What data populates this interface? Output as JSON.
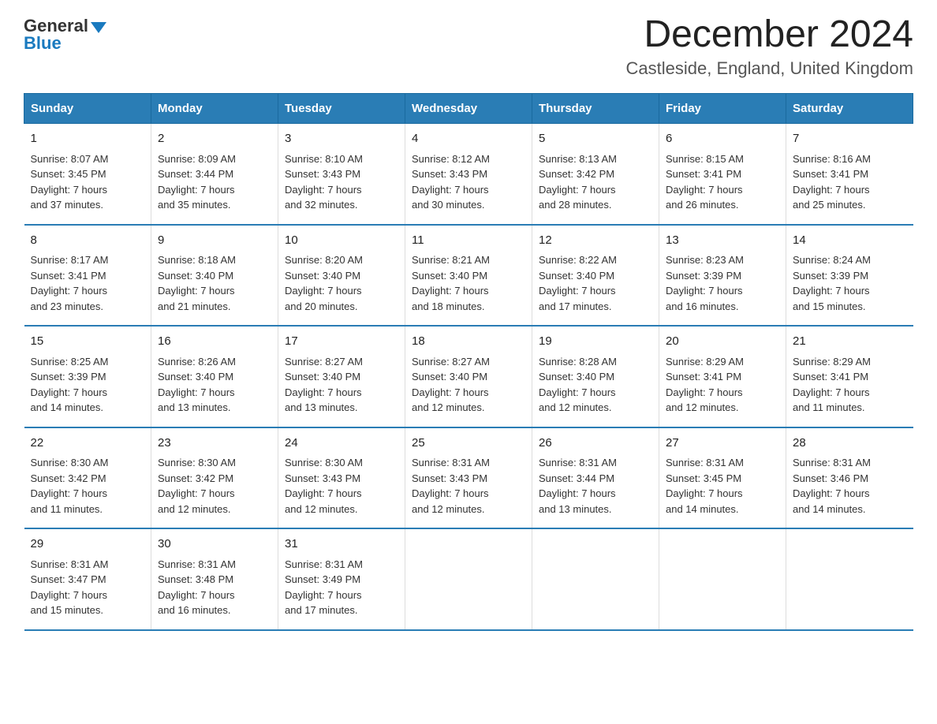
{
  "logo": {
    "general": "General",
    "arrow": "▶",
    "blue": "Blue"
  },
  "header": {
    "month_year": "December 2024",
    "location": "Castleside, England, United Kingdom"
  },
  "weekdays": [
    "Sunday",
    "Monday",
    "Tuesday",
    "Wednesday",
    "Thursday",
    "Friday",
    "Saturday"
  ],
  "weeks": [
    [
      {
        "day": "1",
        "sunrise": "Sunrise: 8:07 AM",
        "sunset": "Sunset: 3:45 PM",
        "daylight": "Daylight: 7 hours",
        "daylight2": "and 37 minutes."
      },
      {
        "day": "2",
        "sunrise": "Sunrise: 8:09 AM",
        "sunset": "Sunset: 3:44 PM",
        "daylight": "Daylight: 7 hours",
        "daylight2": "and 35 minutes."
      },
      {
        "day": "3",
        "sunrise": "Sunrise: 8:10 AM",
        "sunset": "Sunset: 3:43 PM",
        "daylight": "Daylight: 7 hours",
        "daylight2": "and 32 minutes."
      },
      {
        "day": "4",
        "sunrise": "Sunrise: 8:12 AM",
        "sunset": "Sunset: 3:43 PM",
        "daylight": "Daylight: 7 hours",
        "daylight2": "and 30 minutes."
      },
      {
        "day": "5",
        "sunrise": "Sunrise: 8:13 AM",
        "sunset": "Sunset: 3:42 PM",
        "daylight": "Daylight: 7 hours",
        "daylight2": "and 28 minutes."
      },
      {
        "day": "6",
        "sunrise": "Sunrise: 8:15 AM",
        "sunset": "Sunset: 3:41 PM",
        "daylight": "Daylight: 7 hours",
        "daylight2": "and 26 minutes."
      },
      {
        "day": "7",
        "sunrise": "Sunrise: 8:16 AM",
        "sunset": "Sunset: 3:41 PM",
        "daylight": "Daylight: 7 hours",
        "daylight2": "and 25 minutes."
      }
    ],
    [
      {
        "day": "8",
        "sunrise": "Sunrise: 8:17 AM",
        "sunset": "Sunset: 3:41 PM",
        "daylight": "Daylight: 7 hours",
        "daylight2": "and 23 minutes."
      },
      {
        "day": "9",
        "sunrise": "Sunrise: 8:18 AM",
        "sunset": "Sunset: 3:40 PM",
        "daylight": "Daylight: 7 hours",
        "daylight2": "and 21 minutes."
      },
      {
        "day": "10",
        "sunrise": "Sunrise: 8:20 AM",
        "sunset": "Sunset: 3:40 PM",
        "daylight": "Daylight: 7 hours",
        "daylight2": "and 20 minutes."
      },
      {
        "day": "11",
        "sunrise": "Sunrise: 8:21 AM",
        "sunset": "Sunset: 3:40 PM",
        "daylight": "Daylight: 7 hours",
        "daylight2": "and 18 minutes."
      },
      {
        "day": "12",
        "sunrise": "Sunrise: 8:22 AM",
        "sunset": "Sunset: 3:40 PM",
        "daylight": "Daylight: 7 hours",
        "daylight2": "and 17 minutes."
      },
      {
        "day": "13",
        "sunrise": "Sunrise: 8:23 AM",
        "sunset": "Sunset: 3:39 PM",
        "daylight": "Daylight: 7 hours",
        "daylight2": "and 16 minutes."
      },
      {
        "day": "14",
        "sunrise": "Sunrise: 8:24 AM",
        "sunset": "Sunset: 3:39 PM",
        "daylight": "Daylight: 7 hours",
        "daylight2": "and 15 minutes."
      }
    ],
    [
      {
        "day": "15",
        "sunrise": "Sunrise: 8:25 AM",
        "sunset": "Sunset: 3:39 PM",
        "daylight": "Daylight: 7 hours",
        "daylight2": "and 14 minutes."
      },
      {
        "day": "16",
        "sunrise": "Sunrise: 8:26 AM",
        "sunset": "Sunset: 3:40 PM",
        "daylight": "Daylight: 7 hours",
        "daylight2": "and 13 minutes."
      },
      {
        "day": "17",
        "sunrise": "Sunrise: 8:27 AM",
        "sunset": "Sunset: 3:40 PM",
        "daylight": "Daylight: 7 hours",
        "daylight2": "and 13 minutes."
      },
      {
        "day": "18",
        "sunrise": "Sunrise: 8:27 AM",
        "sunset": "Sunset: 3:40 PM",
        "daylight": "Daylight: 7 hours",
        "daylight2": "and 12 minutes."
      },
      {
        "day": "19",
        "sunrise": "Sunrise: 8:28 AM",
        "sunset": "Sunset: 3:40 PM",
        "daylight": "Daylight: 7 hours",
        "daylight2": "and 12 minutes."
      },
      {
        "day": "20",
        "sunrise": "Sunrise: 8:29 AM",
        "sunset": "Sunset: 3:41 PM",
        "daylight": "Daylight: 7 hours",
        "daylight2": "and 12 minutes."
      },
      {
        "day": "21",
        "sunrise": "Sunrise: 8:29 AM",
        "sunset": "Sunset: 3:41 PM",
        "daylight": "Daylight: 7 hours",
        "daylight2": "and 11 minutes."
      }
    ],
    [
      {
        "day": "22",
        "sunrise": "Sunrise: 8:30 AM",
        "sunset": "Sunset: 3:42 PM",
        "daylight": "Daylight: 7 hours",
        "daylight2": "and 11 minutes."
      },
      {
        "day": "23",
        "sunrise": "Sunrise: 8:30 AM",
        "sunset": "Sunset: 3:42 PM",
        "daylight": "Daylight: 7 hours",
        "daylight2": "and 12 minutes."
      },
      {
        "day": "24",
        "sunrise": "Sunrise: 8:30 AM",
        "sunset": "Sunset: 3:43 PM",
        "daylight": "Daylight: 7 hours",
        "daylight2": "and 12 minutes."
      },
      {
        "day": "25",
        "sunrise": "Sunrise: 8:31 AM",
        "sunset": "Sunset: 3:43 PM",
        "daylight": "Daylight: 7 hours",
        "daylight2": "and 12 minutes."
      },
      {
        "day": "26",
        "sunrise": "Sunrise: 8:31 AM",
        "sunset": "Sunset: 3:44 PM",
        "daylight": "Daylight: 7 hours",
        "daylight2": "and 13 minutes."
      },
      {
        "day": "27",
        "sunrise": "Sunrise: 8:31 AM",
        "sunset": "Sunset: 3:45 PM",
        "daylight": "Daylight: 7 hours",
        "daylight2": "and 14 minutes."
      },
      {
        "day": "28",
        "sunrise": "Sunrise: 8:31 AM",
        "sunset": "Sunset: 3:46 PM",
        "daylight": "Daylight: 7 hours",
        "daylight2": "and 14 minutes."
      }
    ],
    [
      {
        "day": "29",
        "sunrise": "Sunrise: 8:31 AM",
        "sunset": "Sunset: 3:47 PM",
        "daylight": "Daylight: 7 hours",
        "daylight2": "and 15 minutes."
      },
      {
        "day": "30",
        "sunrise": "Sunrise: 8:31 AM",
        "sunset": "Sunset: 3:48 PM",
        "daylight": "Daylight: 7 hours",
        "daylight2": "and 16 minutes."
      },
      {
        "day": "31",
        "sunrise": "Sunrise: 8:31 AM",
        "sunset": "Sunset: 3:49 PM",
        "daylight": "Daylight: 7 hours",
        "daylight2": "and 17 minutes."
      },
      null,
      null,
      null,
      null
    ]
  ]
}
